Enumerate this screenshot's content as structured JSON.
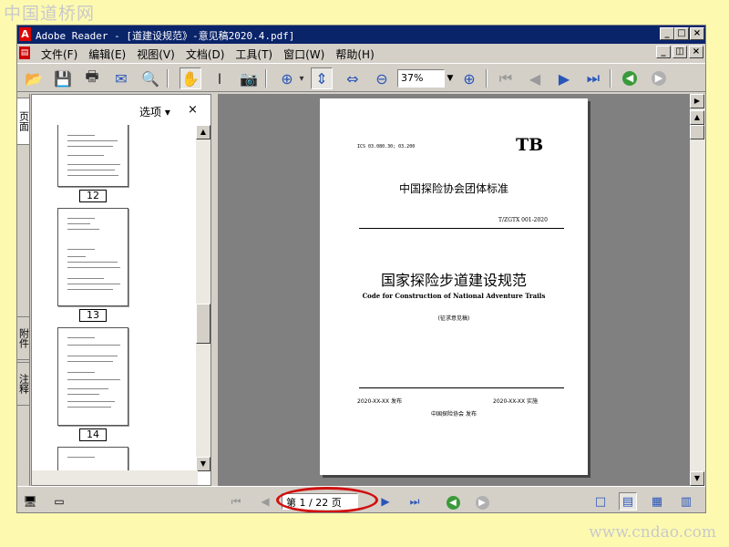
{
  "watermark": {
    "top": "中国道桥网",
    "bottom": "www.cndao.com"
  },
  "window": {
    "title": "Adobe Reader - [道建设规范》-意见稿2020.4.pdf]",
    "app_icon_glyph": "A",
    "controls": {
      "minimize": "_",
      "maximize": "□",
      "close": "×",
      "restore": "◫"
    }
  },
  "menu": {
    "doc_icon_glyph": "▤",
    "items": [
      {
        "label": "文件(F)"
      },
      {
        "label": "编辑(E)"
      },
      {
        "label": "视图(V)"
      },
      {
        "label": "文档(D)"
      },
      {
        "label": "工具(T)"
      },
      {
        "label": "窗口(W)"
      },
      {
        "label": "帮助(H)"
      }
    ]
  },
  "toolbar": {
    "icons": {
      "open": "📂",
      "save": "💾",
      "print": "🖶",
      "email": "✉",
      "search": "🔍",
      "hand": "✋",
      "select": "I",
      "snapshot": "📷",
      "zoom_tool": "⊕",
      "zoom_drop": "▾",
      "fit_page": "⇕",
      "fit_width": "⇔",
      "zoom_out": "⊖",
      "zoom_in": "⊕",
      "first": "⏮",
      "prev": "◀",
      "next": "▶",
      "last": "⏭",
      "back": "◀",
      "forward": "▶"
    },
    "zoom_value": "37%",
    "zoom_drop_glyph": "▼"
  },
  "left_tabs": {
    "pages": "页面",
    "attachments": "附件",
    "comments": "注释"
  },
  "side_panel": {
    "options_label": "选项 ▾",
    "close_glyph": "×",
    "thumbnails": [
      {
        "label": "12"
      },
      {
        "label": "13"
      },
      {
        "label": "14"
      }
    ]
  },
  "document_page": {
    "ics": "ICS 03.080.30; 03.200",
    "standard_mark": "TB",
    "organization": "中国探险协会团体标准",
    "code": "T/ZGTX 001-2020",
    "title_cn": "国家探险步道建设规范",
    "title_en": "Code for Construction of National Adventure Trails",
    "draft": "(征求意见稿)",
    "publish_date": "2020-XX-XX  发布",
    "implement_date": "2020-XX-XX  实施",
    "published_by": "中国探险协会   发布"
  },
  "status_bar": {
    "page_indicator": "第 1 / 22 页",
    "icons": {
      "first": "⏮",
      "prev": "◀",
      "next": "▶",
      "last": "⏭",
      "back": "◀",
      "forward": "▶",
      "single": "□",
      "continuous": "▤",
      "facing": "▦",
      "cont_facing": "▥",
      "monitor": "🖥",
      "doc": "▭"
    }
  },
  "colors": {
    "titlebar": "#0a246a",
    "highlight": "#d01010",
    "doc_bg": "#808080",
    "nav_green": "#3a9a3a"
  }
}
